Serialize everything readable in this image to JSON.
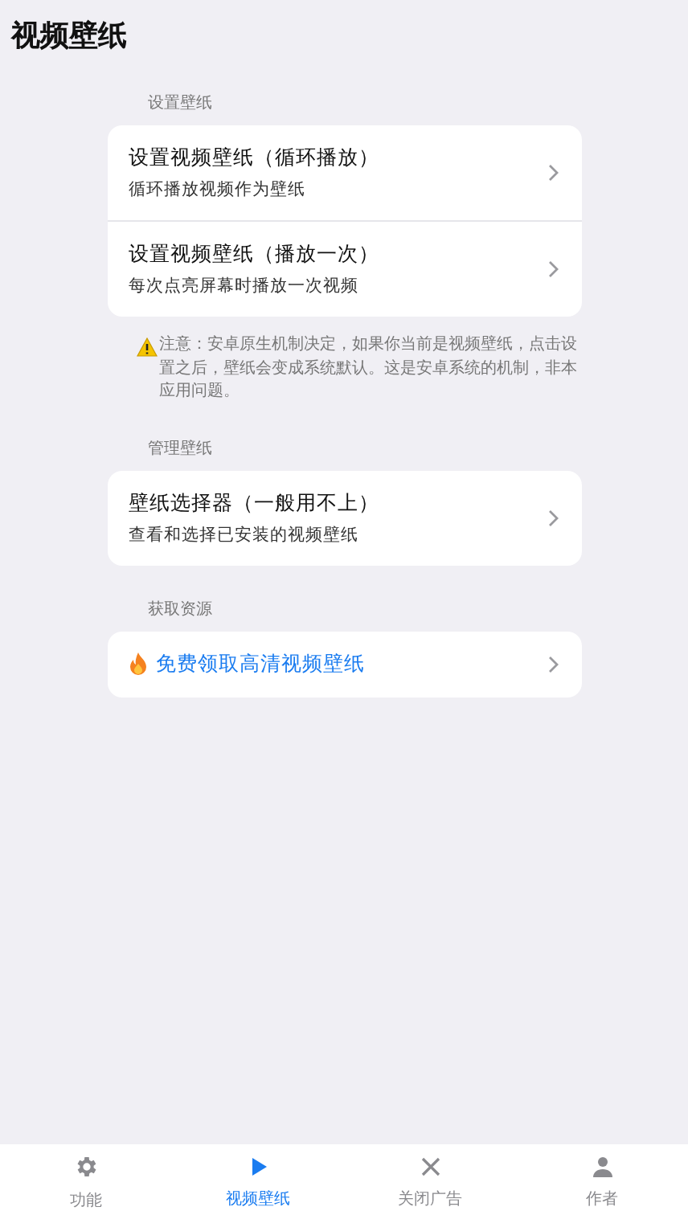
{
  "title": "视频壁纸",
  "sections": [
    {
      "header": "设置壁纸",
      "rows": [
        {
          "kind": "nav",
          "title": "设置视频壁纸（循环播放）",
          "subtitle": "循环播放视频作为壁纸"
        },
        {
          "kind": "nav",
          "title": "设置视频壁纸（播放一次）",
          "subtitle": "每次点亮屏幕时播放一次视频"
        }
      ],
      "note": "注意：安卓原生机制决定，如果你当前是视频壁纸，点击设置之后，壁纸会变成系统默认。这是安卓系统的机制，非本应用问题。"
    },
    {
      "header": "管理壁纸",
      "rows": [
        {
          "kind": "nav",
          "title": "壁纸选择器（一般用不上）",
          "subtitle": "查看和选择已安装的视频壁纸"
        }
      ]
    },
    {
      "header": "获取资源",
      "rows": [
        {
          "kind": "promo",
          "title": "免费领取高清视频壁纸"
        }
      ]
    }
  ],
  "tabs": [
    {
      "kind": "gear",
      "label": "功能",
      "selected": false
    },
    {
      "kind": "play",
      "label": "视频壁纸",
      "selected": true
    },
    {
      "kind": "close",
      "label": "关闭广告",
      "selected": false
    },
    {
      "kind": "person",
      "label": "作者",
      "selected": false
    }
  ]
}
